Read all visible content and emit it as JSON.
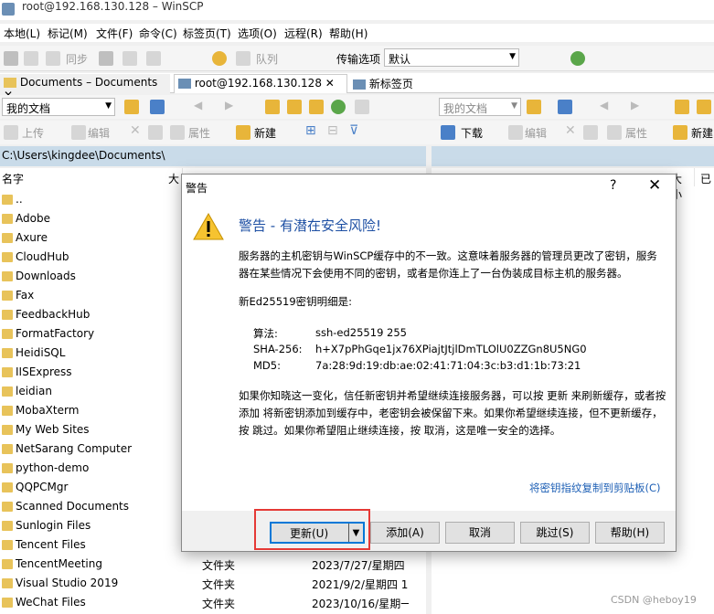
{
  "window": {
    "title": "root@192.168.130.128 – WinSCP"
  },
  "menu": [
    "本地(L)",
    "标记(M)",
    "文件(F)",
    "命令(C)",
    "标签页(T)",
    "选项(O)",
    "远程(R)",
    "帮助(H)"
  ],
  "toolbar": {
    "sync": "同步",
    "queue": "队列",
    "transfer_label": "传输选项",
    "transfer_value": "默认"
  },
  "tabs": [
    "Documents – Documents",
    "root@192.168.130.128",
    "新标签页"
  ],
  "left_toolbar": {
    "location": "我的文档",
    "upload": "上传",
    "edit": "编辑",
    "props": "属性",
    "new": "新建"
  },
  "right_toolbar": {
    "location": "我的文档",
    "download": "下载",
    "edit": "编辑",
    "props": "属性",
    "new": "新建"
  },
  "left_path": "C:\\Users\\kingdee\\Documents\\",
  "left_columns": {
    "name": "名字",
    "size": "大"
  },
  "right_columns": {
    "size": "大小",
    "changed": "已"
  },
  "files": [
    {
      "name": ".."
    },
    {
      "name": "Adobe"
    },
    {
      "name": "Axure"
    },
    {
      "name": "CloudHub"
    },
    {
      "name": "Downloads"
    },
    {
      "name": "Fax"
    },
    {
      "name": "FeedbackHub"
    },
    {
      "name": "FormatFactory"
    },
    {
      "name": "HeidiSQL"
    },
    {
      "name": "IISExpress"
    },
    {
      "name": "leidian"
    },
    {
      "name": "MobaXterm"
    },
    {
      "name": "My Web Sites"
    },
    {
      "name": "NetSarang Computer"
    },
    {
      "name": "python-demo"
    },
    {
      "name": "QQPCMgr"
    },
    {
      "name": "Scanned Documents"
    },
    {
      "name": "Sunlogin Files"
    },
    {
      "name": "Tencent Files"
    },
    {
      "name": "TencentMeeting",
      "type": "文件夹",
      "date": "2023/7/27/星期四"
    },
    {
      "name": "Visual Studio 2019",
      "type": "文件夹",
      "date": "2021/9/2/星期四 1"
    },
    {
      "name": "WeChat Files",
      "type": "文件夹",
      "date": "2023/10/16/星期一"
    }
  ],
  "dialog": {
    "title": "警告",
    "help": "?",
    "close": "✕",
    "heading": "警告 - 有潜在安全风险!",
    "p1": "服务器的主机密钥与WinSCP缓存中的不一致。这意味着服务器的管理员更改了密钥，服务器在某些情况下会使用不同的密钥，或者是你连上了一台伪装成目标主机的服务器。",
    "p2": "新Ed25519密钥明细是:",
    "algo_label": "算法:",
    "algo_value": "ssh-ed25519 255",
    "sha_label": "SHA-256:",
    "sha_value": "h+X7pPhGqe1jx76XPiajtJtjlDmTLOlU0ZZGn8U5NG0",
    "md5_label": "MD5:",
    "md5_value": "7a:28:9d:19:db:ae:02:41:71:04:3c:b3:d1:1b:73:21",
    "p3": "如果你知晓这一变化，信任新密钥并希望继续连接服务器，可以按 更新 来刷新缓存，或者按 添加 将新密钥添加到缓存中，老密钥会被保留下来。如果你希望继续连接，但不更新缓存，按 跳过。如果你希望阻止继续连接，按 取消，这是唯一安全的选择。",
    "copy_link": "将密钥指纹复制到剪贴板(C)",
    "buttons": {
      "update": "更新(U)",
      "add": "添加(A)",
      "cancel": "取消",
      "skip": "跳过(S)",
      "help": "帮助(H)"
    }
  },
  "watermark": "CSDN @heboy19",
  "colors": {
    "accent": "#0078d7",
    "heading": "#1d4fa3",
    "highlight": "#e53935",
    "path_bg": "#c9dbe9"
  }
}
